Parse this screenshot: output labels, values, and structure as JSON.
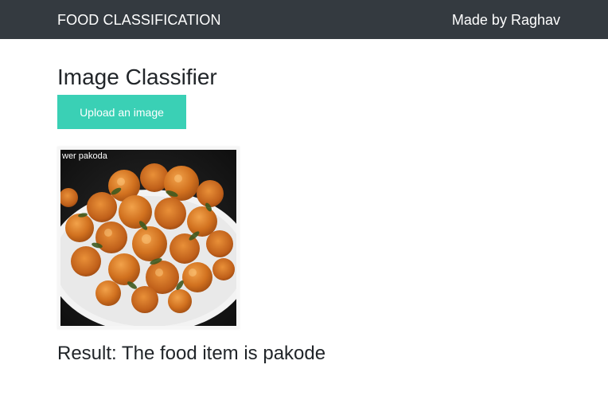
{
  "navbar": {
    "brand": "FOOD CLASSIFICATION",
    "author": "Made by Raghav",
    "background": "#343a40"
  },
  "main": {
    "title": "Image Classifier",
    "upload_label": "Upload an image",
    "upload_color": "#3ad0b5",
    "preview_caption": "wer pakoda",
    "result": "Result: The food item is pakode"
  }
}
